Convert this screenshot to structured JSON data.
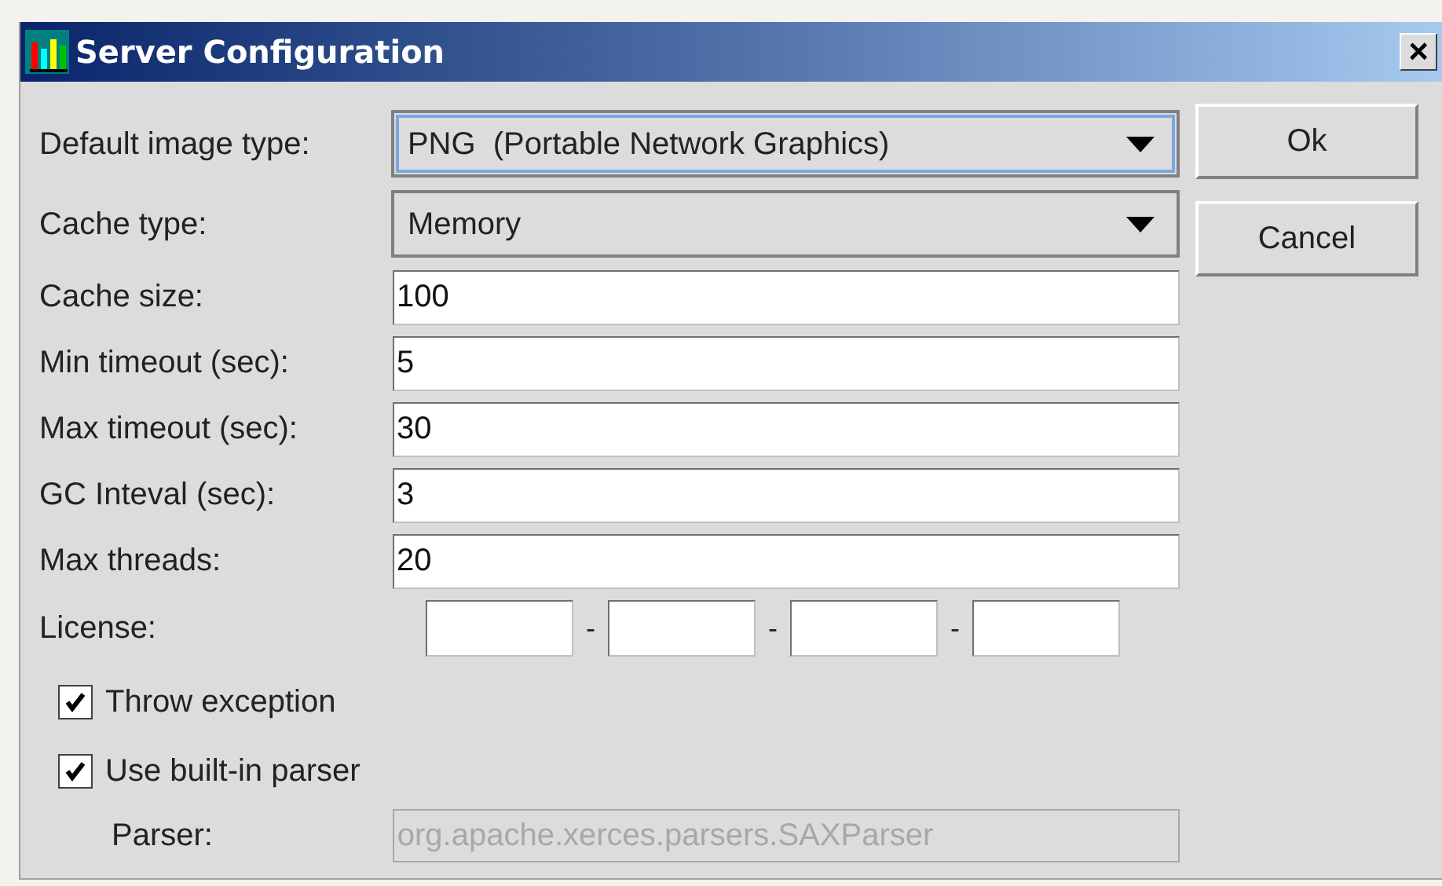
{
  "window": {
    "title": "Server Configuration",
    "close": "×"
  },
  "fields": [
    {
      "kind": "combo",
      "label": "Default image type:",
      "value": "PNG  (Portable Network Graphics)",
      "focused": true
    },
    {
      "kind": "combo",
      "label": "Cache type:",
      "value": "Memory",
      "focused": false
    },
    {
      "kind": "text",
      "label": "Cache size:",
      "value": "100"
    },
    {
      "kind": "text",
      "label": "Min timeout (sec):",
      "value": "5"
    },
    {
      "kind": "text",
      "label": "Max timeout (sec):",
      "value": "30"
    },
    {
      "kind": "text",
      "label": "GC Inteval (sec):",
      "value": "3"
    },
    {
      "kind": "text",
      "label": "Max threads:",
      "value": "20"
    }
  ],
  "license": {
    "label": "License:",
    "separators": [
      "-",
      "-",
      "-"
    ]
  },
  "checkboxes": [
    {
      "label": "Throw exception",
      "checked": true
    },
    {
      "label": "Use built-in parser",
      "checked": true
    }
  ],
  "parser": {
    "label": "Parser:",
    "placeholder": "org.apache.xerces.parsers.SAXParser",
    "disabled": true
  },
  "buttons": [
    "Ok",
    "Cancel"
  ]
}
